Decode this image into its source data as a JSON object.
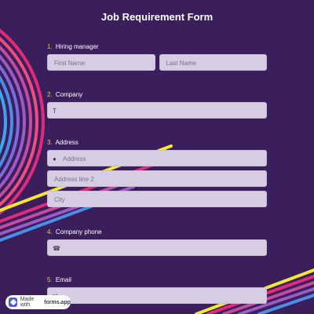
{
  "form": {
    "title": "Job Requirement Form",
    "questions": [
      {
        "num": "1.",
        "label": "Hiring manager",
        "placeholders": [
          "First Name",
          "Last Name"
        ]
      },
      {
        "num": "2.",
        "label": "Company",
        "icon": "text-type-icon",
        "placeholder": ""
      },
      {
        "num": "3.",
        "label": "Address",
        "icon": "location-pin-icon",
        "placeholders": [
          "Address",
          "Address line 2",
          "City"
        ]
      },
      {
        "num": "4.",
        "label": "Company phone",
        "icon": "phone-icon",
        "placeholder": ""
      },
      {
        "num": "5.",
        "label": "Email",
        "icon": "mail-icon",
        "placeholder": ""
      }
    ]
  },
  "badge": {
    "prefix": "Made with",
    "brand": "forms.app"
  },
  "colors": {
    "background": "#3a1f5c",
    "field": "#d6cde3",
    "number": "#f4c84a"
  }
}
